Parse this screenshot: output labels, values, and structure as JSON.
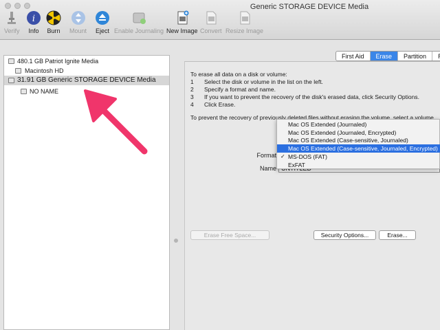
{
  "window": {
    "title": "Generic STORAGE DEVICE Media"
  },
  "toolbar": {
    "items": [
      {
        "label": "Verify",
        "icon": "microscope-icon",
        "enabled": false
      },
      {
        "label": "Info",
        "icon": "info-icon",
        "enabled": true
      },
      {
        "label": "Burn",
        "icon": "burn-icon",
        "enabled": true
      },
      {
        "label": "Mount",
        "icon": "mount-icon",
        "enabled": false
      },
      {
        "label": "Eject",
        "icon": "eject-icon",
        "enabled": true
      },
      {
        "label": "Enable Journaling",
        "icon": "journal-icon",
        "enabled": false
      },
      {
        "label": "New Image",
        "icon": "new-image-icon",
        "enabled": true
      },
      {
        "label": "Convert",
        "icon": "convert-icon",
        "enabled": false
      },
      {
        "label": "Resize Image",
        "icon": "resize-image-icon",
        "enabled": false
      }
    ]
  },
  "sidebar": {
    "items": [
      {
        "label": "480.1 GB Patriot Ignite Media",
        "level": 0,
        "selected": false
      },
      {
        "label": "Macintosh HD",
        "level": 1,
        "selected": false
      },
      {
        "label": "31.91 GB Generic STORAGE DEVICE Media",
        "level": 0,
        "selected": true
      },
      {
        "label": "NO NAME",
        "level": 1,
        "selected": false
      }
    ]
  },
  "tabs": [
    {
      "label": "First Aid",
      "active": false
    },
    {
      "label": "Erase",
      "active": true
    },
    {
      "label": "Partition",
      "active": false
    },
    {
      "label": "RAI",
      "active": false
    }
  ],
  "erase": {
    "intro": "To erase all data on a disk or volume:",
    "steps": [
      {
        "num": "1",
        "text": "Select the disk or volume in the list on the left."
      },
      {
        "num": "2",
        "text": "Specify a format and name."
      },
      {
        "num": "3",
        "text": "If you want to prevent the recovery of the disk's erased data, click Security Options."
      },
      {
        "num": "4",
        "text": "Click Erase."
      }
    ],
    "note": "To prevent the recovery of previously deleted files without erasing the volume, select a volume",
    "format_label": "Format",
    "name_label": "Name",
    "name_value": "UNTITLED",
    "format_options": [
      {
        "label": "Mac OS Extended (Journaled)",
        "checked": false,
        "highlighted": false
      },
      {
        "label": "Mac OS Extended (Journaled, Encrypted)",
        "checked": false,
        "highlighted": false
      },
      {
        "label": "Mac OS Extended (Case-sensitive, Journaled)",
        "checked": false,
        "highlighted": false
      },
      {
        "label": "Mac OS Extended (Case-sensitive, Journaled, Encrypted)",
        "checked": false,
        "highlighted": true
      },
      {
        "label": "MS-DOS (FAT)",
        "checked": true,
        "highlighted": false
      },
      {
        "label": "ExFAT",
        "checked": false,
        "highlighted": false
      }
    ],
    "checkmark": "✓",
    "erase_free_space_label": "Erase Free Space...",
    "security_options_label": "Security Options...",
    "erase_label": "Erase..."
  },
  "colors": {
    "accent": "#2b6fe0",
    "annotation": "#f0356b"
  }
}
